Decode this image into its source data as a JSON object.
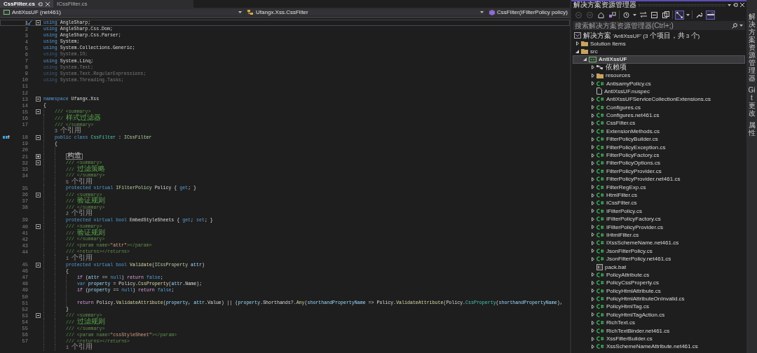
{
  "editor": {
    "tabs": [
      {
        "label": "CssFilter.cs",
        "selected": true
      },
      {
        "label": "ICssFilter.cs",
        "selected": false
      }
    ],
    "nav": {
      "project": "AntiXssUF (net461)",
      "type": "Ufangx.Xss.CssFilter",
      "member": "CssFilter(IFilterPolicy policy)"
    },
    "lines": [
      {
        "n": "1",
        "current": true,
        "expanded": true,
        "quick_action": true,
        "s": [
          {
            "kind": "kw",
            "text": "using"
          },
          {
            "kind": "plain",
            "text": " AngleSharp;"
          }
        ]
      },
      {
        "n": "2",
        "s": [
          {
            "kind": "kw",
            "text": "using"
          },
          {
            "kind": "plain",
            "text": " AngleSharp.Css.Dom;"
          }
        ]
      },
      {
        "n": "3",
        "s": [
          {
            "kind": "kw",
            "text": "using"
          },
          {
            "kind": "plain",
            "text": " AngleSharp.Css.Parser;"
          }
        ]
      },
      {
        "n": "4",
        "s": [
          {
            "kind": "kw",
            "text": "using"
          },
          {
            "kind": "plain",
            "text": " System;"
          }
        ]
      },
      {
        "n": "5",
        "s": [
          {
            "kind": "kw",
            "text": "using"
          },
          {
            "kind": "plain",
            "text": " System.Collections.Generic;"
          }
        ]
      },
      {
        "n": "6",
        "s": [
          {
            "kind": "dimkw",
            "text": "using"
          },
          {
            "kind": "dim",
            "text": " System.IO;"
          }
        ]
      },
      {
        "n": "7",
        "s": [
          {
            "kind": "kw",
            "text": "using"
          },
          {
            "kind": "plain",
            "text": " System.Linq;"
          }
        ]
      },
      {
        "n": "8",
        "s": [
          {
            "kind": "dimkw",
            "text": "using"
          },
          {
            "kind": "dim",
            "text": " System.Text;"
          }
        ]
      },
      {
        "n": "9",
        "s": [
          {
            "kind": "dimkw",
            "text": "using"
          },
          {
            "kind": "dim",
            "text": " System.Text.RegularExpressions;"
          }
        ]
      },
      {
        "n": "10",
        "s": [
          {
            "kind": "dimkw",
            "text": "using"
          },
          {
            "kind": "dim",
            "text": " System.Threading.Tasks;"
          }
        ]
      },
      {
        "n": "11"
      },
      {
        "n": "12"
      },
      {
        "n": "13",
        "expanded": true,
        "s": [
          {
            "kind": "kw",
            "text": "namespace"
          },
          {
            "kind": "plain",
            "text": " Ufangx.Xss"
          }
        ]
      },
      {
        "n": "14",
        "s": [
          {
            "kind": "plain",
            "text": "{"
          }
        ],
        "children": [
          {
            "n": "15",
            "expanded": true,
            "s": [
              {
                "kind": "cmt",
                "text": "/// "
              },
              {
                "kind": "xml",
                "text": "<summary>"
              }
            ]
          },
          {
            "n": "16",
            "s": [
              {
                "kind": "cmt",
                "text": "/// 样式过滤器"
              }
            ]
          },
          {
            "n": "17",
            "s": [
              {
                "kind": "cmt",
                "text": "/// "
              },
              {
                "kind": "xml",
                "text": "</summary>"
              }
            ]
          },
          {
            "kind": "lens",
            "text": "3 个引用"
          },
          {
            "n": "18",
            "expanded": true,
            "implements": true,
            "s": [
              {
                "kind": "kw",
                "text": "public class "
              },
              {
                "kind": "type",
                "text": "CssFilter"
              },
              {
                "kind": "plain",
                "text": " : "
              },
              {
                "kind": "iface",
                "text": "ICssFilter"
              }
            ]
          },
          {
            "n": "19",
            "s": [
              {
                "kind": "plain",
                "text": "{"
              }
            ],
            "children": [
              {
                "n": "20"
              },
              {
                "n": "21",
                "expanded": false,
                "s": [
                  {
                    "kind": "box",
                    "text": "构造"
                  }
                ]
              },
              {
                "n": "32",
                "expanded": true,
                "s": [
                  {
                    "kind": "cmt",
                    "text": "/// "
                  },
                  {
                    "kind": "xml",
                    "text": "<summary>"
                  }
                ]
              },
              {
                "n": "33",
                "s": [
                  {
                    "kind": "cmt",
                    "text": "/// 过滤策略"
                  }
                ]
              },
              {
                "n": "34",
                "s": [
                  {
                    "kind": "cmt",
                    "text": "/// "
                  },
                  {
                    "kind": "xml",
                    "text": "</summary>"
                  }
                ]
              },
              {
                "kind": "lens",
                "text": "5 个引用"
              },
              {
                "n": "35",
                "s": [
                  {
                    "kind": "kw",
                    "text": "protected virtual "
                  },
                  {
                    "kind": "iface",
                    "text": "IFilterPolicy"
                  },
                  {
                    "kind": "plain",
                    "text": " Policy { "
                  },
                  {
                    "kind": "kw",
                    "text": "get"
                  },
                  {
                    "kind": "plain",
                    "text": "; }"
                  }
                ]
              },
              {
                "n": "36",
                "expanded": true,
                "s": [
                  {
                    "kind": "cmt",
                    "text": "/// "
                  },
                  {
                    "kind": "xml",
                    "text": "<summary>"
                  }
                ]
              },
              {
                "n": "37",
                "s": [
                  {
                    "kind": "cmt",
                    "text": "/// 验证规则"
                  }
                ]
              },
              {
                "n": "38",
                "s": [
                  {
                    "kind": "cmt",
                    "text": "/// "
                  },
                  {
                    "kind": "xml",
                    "text": "</summary>"
                  }
                ]
              },
              {
                "kind": "lens",
                "text": "2 个引用"
              },
              {
                "n": "39",
                "s": [
                  {
                    "kind": "kw",
                    "text": "protected virtual bool"
                  },
                  {
                    "kind": "plain",
                    "text": " EmbedStyleSheets { "
                  },
                  {
                    "kind": "kw",
                    "text": "get"
                  },
                  {
                    "kind": "plain",
                    "text": "; "
                  },
                  {
                    "kind": "kw",
                    "text": "set"
                  },
                  {
                    "kind": "plain",
                    "text": "; }"
                  }
                ]
              },
              {
                "n": "40",
                "expanded": true,
                "s": [
                  {
                    "kind": "cmt",
                    "text": "/// "
                  },
                  {
                    "kind": "xml",
                    "text": "<summary>"
                  }
                ]
              },
              {
                "n": "41",
                "s": [
                  {
                    "kind": "cmt",
                    "text": "/// 验证规则"
                  }
                ]
              },
              {
                "n": "42",
                "s": [
                  {
                    "kind": "cmt",
                    "text": "/// "
                  },
                  {
                    "kind": "xml",
                    "text": "</summary>"
                  }
                ]
              },
              {
                "n": "43",
                "s": [
                  {
                    "kind": "cmt",
                    "text": "/// "
                  },
                  {
                    "kind": "xml",
                    "text": "<param name="
                  },
                  {
                    "kind": "str",
                    "text": "\"attr\""
                  },
                  {
                    "kind": "xml",
                    "text": "></param>"
                  }
                ]
              },
              {
                "n": "44",
                "s": [
                  {
                    "kind": "cmt",
                    "text": "/// "
                  },
                  {
                    "kind": "xml",
                    "text": "<returns></returns>"
                  }
                ]
              },
              {
                "kind": "lens",
                "text": "1 个引用"
              },
              {
                "n": "45",
                "expanded": true,
                "s": [
                  {
                    "kind": "kw",
                    "text": "protected virtual bool "
                  },
                  {
                    "kind": "method",
                    "text": "Validate"
                  },
                  {
                    "kind": "plain",
                    "text": "("
                  },
                  {
                    "kind": "iface",
                    "text": "ICssProperty"
                  },
                  {
                    "kind": "var",
                    "text": " attr"
                  },
                  {
                    "kind": "plain",
                    "text": ")"
                  }
                ]
              },
              {
                "n": "46",
                "s": [
                  {
                    "kind": "plain",
                    "text": "{"
                  }
                ],
                "children": [
                  {
                    "n": "47",
                    "s": [
                      {
                        "kind": "ctl",
                        "text": "if"
                      },
                      {
                        "kind": "plain",
                        "text": " ("
                      },
                      {
                        "kind": "var",
                        "text": "attr"
                      },
                      {
                        "kind": "plain",
                        "text": " == "
                      },
                      {
                        "kind": "kw",
                        "text": "null"
                      },
                      {
                        "kind": "plain",
                        "text": ") "
                      },
                      {
                        "kind": "ctl",
                        "text": "return"
                      },
                      {
                        "kind": "kw",
                        "text": " false"
                      },
                      {
                        "kind": "plain",
                        "text": ";"
                      }
                    ]
                  },
                  {
                    "n": "48",
                    "s": [
                      {
                        "kind": "kw",
                        "text": "var"
                      },
                      {
                        "kind": "var",
                        "text": " property"
                      },
                      {
                        "kind": "plain",
                        "text": " = Policy."
                      },
                      {
                        "kind": "method",
                        "text": "CssProperty"
                      },
                      {
                        "kind": "plain",
                        "text": "("
                      },
                      {
                        "kind": "var",
                        "text": "attr"
                      },
                      {
                        "kind": "plain",
                        "text": ".Name);"
                      }
                    ]
                  },
                  {
                    "n": "49",
                    "s": [
                      {
                        "kind": "ctl",
                        "text": "if"
                      },
                      {
                        "kind": "plain",
                        "text": " ("
                      },
                      {
                        "kind": "var",
                        "text": "property"
                      },
                      {
                        "kind": "plain",
                        "text": " == "
                      },
                      {
                        "kind": "kw",
                        "text": "null"
                      },
                      {
                        "kind": "plain",
                        "text": ") "
                      },
                      {
                        "kind": "ctl",
                        "text": "return"
                      },
                      {
                        "kind": "kw",
                        "text": " false"
                      },
                      {
                        "kind": "plain",
                        "text": ";"
                      }
                    ]
                  },
                  {
                    "n": "50"
                  },
                  {
                    "n": "51",
                    "s": [
                      {
                        "kind": "ctl",
                        "text": "return"
                      },
                      {
                        "kind": "plain",
                        "text": " Policy."
                      },
                      {
                        "kind": "method",
                        "text": "ValidateAttribute"
                      },
                      {
                        "kind": "plain",
                        "text": "("
                      },
                      {
                        "kind": "var",
                        "text": "property"
                      },
                      {
                        "kind": "plain",
                        "text": ", "
                      },
                      {
                        "kind": "var",
                        "text": "attr"
                      },
                      {
                        "kind": "plain",
                        "text": ".Value) || ("
                      },
                      {
                        "kind": "var",
                        "text": "property"
                      },
                      {
                        "kind": "plain",
                        "text": ".Shorthands?."
                      },
                      {
                        "kind": "method",
                        "text": "Any"
                      },
                      {
                        "kind": "plain",
                        "text": "("
                      },
                      {
                        "kind": "var",
                        "text": "shorthandPropertyName"
                      },
                      {
                        "kind": "plain",
                        "text": " => Policy."
                      },
                      {
                        "kind": "method",
                        "text": "ValidateAttribute"
                      },
                      {
                        "kind": "plain",
                        "text": "(Policy."
                      },
                      {
                        "kind": "type",
                        "text": "CssProperty"
                      },
                      {
                        "kind": "plain",
                        "text": "("
                      },
                      {
                        "kind": "var",
                        "text": "shorthandPropertyName"
                      },
                      {
                        "kind": "plain",
                        "text": "),"
                      }
                    ]
                  }
                ]
              },
              {
                "n": "52",
                "s": [
                  {
                    "kind": "plain",
                    "text": "}"
                  }
                ]
              },
              {
                "n": "53",
                "expanded": true,
                "s": [
                  {
                    "kind": "cmt",
                    "text": "/// "
                  },
                  {
                    "kind": "xml",
                    "text": "<summary>"
                  }
                ]
              },
              {
                "n": "54",
                "s": [
                  {
                    "kind": "cmt",
                    "text": "/// 过滤规则"
                  }
                ]
              },
              {
                "n": "55",
                "s": [
                  {
                    "kind": "cmt",
                    "text": "/// "
                  },
                  {
                    "kind": "xml",
                    "text": "</summary>"
                  }
                ]
              },
              {
                "n": "56",
                "s": [
                  {
                    "kind": "cmt",
                    "text": "/// "
                  },
                  {
                    "kind": "xml",
                    "text": "<param name="
                  },
                  {
                    "kind": "str",
                    "text": "\"cssStyleSheet\""
                  },
                  {
                    "kind": "xml",
                    "text": "></param>"
                  }
                ]
              },
              {
                "n": "57",
                "s": [
                  {
                    "kind": "cmt",
                    "text": "/// "
                  },
                  {
                    "kind": "xml",
                    "text": "<returns></returns>"
                  }
                ]
              },
              {
                "kind": "lens",
                "text": "1 个引用"
              }
            ]
          }
        ]
      }
    ]
  },
  "solution_explorer": {
    "title": "解决方案资源管理器",
    "search": {
      "placeholder": "搜索解决方案资源管理器(Ctrl+;)"
    },
    "tree": {
      "label": "解决方案 'AntiXssUF' (3 个项目，共 3 个)",
      "kind": "solution",
      "selected": false,
      "children": [
        {
          "label": "Solution Items",
          "kind": "folder",
          "expanded": false,
          "selected": false
        },
        {
          "label": "src",
          "kind": "folder",
          "expanded": true,
          "selected": false,
          "children": [
            {
              "label": "AntiXssUF",
              "kind": "project",
              "expanded": true,
              "selected": true,
              "children": [
                {
                  "label": "依赖项",
                  "kind": "deps",
                  "expanded": false,
                  "selected": false
                },
                {
                  "label": "resources",
                  "kind": "folder",
                  "expanded": false,
                  "selected": false
                },
                {
                  "label": "AntisamyPolicy.cs",
                  "kind": "csharp",
                  "expanded": false,
                  "selected": false
                },
                {
                  "label": "AntiXssUF.nuspec",
                  "kind": "file",
                  "selected": false
                },
                {
                  "label": "AntiXssUFServiceCollectionExtensions.cs",
                  "kind": "csharp",
                  "expanded": false,
                  "selected": false
                },
                {
                  "label": "Configures.cs",
                  "kind": "csharp",
                  "expanded": false,
                  "selected": false
                },
                {
                  "label": "Configures.net461.cs",
                  "kind": "csharp",
                  "expanded": false,
                  "selected": false
                },
                {
                  "label": "CssFilter.cs",
                  "kind": "csharp",
                  "expanded": false,
                  "selected": false
                },
                {
                  "label": "ExtensionMethods.cs",
                  "kind": "csharp",
                  "expanded": false,
                  "selected": false
                },
                {
                  "label": "FilterPolicyBuilder.cs",
                  "kind": "csharp",
                  "expanded": false,
                  "selected": false
                },
                {
                  "label": "FilterPolicyException.cs",
                  "kind": "csharp",
                  "expanded": false,
                  "selected": false
                },
                {
                  "label": "FilterPolicyFactory.cs",
                  "kind": "csharp",
                  "expanded": false,
                  "selected": false
                },
                {
                  "label": "FilterPolicyOptions.cs",
                  "kind": "csharp",
                  "expanded": false,
                  "selected": false
                },
                {
                  "label": "FilterPolicyProvider.cs",
                  "kind": "csharp",
                  "expanded": false,
                  "selected": false
                },
                {
                  "label": "FilterPolicyProvider.net461.cs",
                  "kind": "csharp",
                  "expanded": false,
                  "selected": false
                },
                {
                  "label": "FilterRegExp.cs",
                  "kind": "csharp",
                  "expanded": false,
                  "selected": false
                },
                {
                  "label": "HtmlFilter.cs",
                  "kind": "csharp",
                  "expanded": false,
                  "selected": false
                },
                {
                  "label": "ICssFilter.cs",
                  "kind": "csharp",
                  "expanded": false,
                  "selected": false
                },
                {
                  "label": "IFilterPolicy.cs",
                  "kind": "csharp",
                  "expanded": false,
                  "selected": false
                },
                {
                  "label": "IFilterPolicyFactory.cs",
                  "kind": "csharp",
                  "expanded": false,
                  "selected": false
                },
                {
                  "label": "IFilterPolicyProvider.cs",
                  "kind": "csharp",
                  "expanded": false,
                  "selected": false
                },
                {
                  "label": "IHtmlFilter.cs",
                  "kind": "csharp",
                  "expanded": false,
                  "selected": false
                },
                {
                  "label": "IXssSchemeName.net461.cs",
                  "kind": "csharp",
                  "expanded": false,
                  "selected": false
                },
                {
                  "label": "JsonFilterPolicy.cs",
                  "kind": "csharp",
                  "expanded": false,
                  "selected": false
                },
                {
                  "label": "JsonFilterPolicy.net461.cs",
                  "kind": "csharp",
                  "expanded": false,
                  "selected": false
                },
                {
                  "label": "pack.bat",
                  "kind": "bat",
                  "selected": false
                },
                {
                  "label": "PolicyAttribute.cs",
                  "kind": "csharp",
                  "expanded": false,
                  "selected": false
                },
                {
                  "label": "PolicyCssProperty.cs",
                  "kind": "csharp",
                  "expanded": false,
                  "selected": false
                },
                {
                  "label": "PolicyHtmlAttribute.cs",
                  "kind": "csharp",
                  "expanded": false,
                  "selected": false
                },
                {
                  "label": "PolicyHtmlAttributeOnInvalid.cs",
                  "kind": "csharp",
                  "expanded": false,
                  "selected": false
                },
                {
                  "label": "PolicyHtmlTag.cs",
                  "kind": "csharp",
                  "expanded": false,
                  "selected": false
                },
                {
                  "label": "PolicyHtmlTagAction.cs",
                  "kind": "csharp",
                  "expanded": false,
                  "selected": false
                },
                {
                  "label": "RichText.cs",
                  "kind": "csharp",
                  "expanded": false,
                  "selected": false
                },
                {
                  "label": "RichTextBinder.net461.cs",
                  "kind": "csharp",
                  "expanded": false,
                  "selected": false
                },
                {
                  "label": "XssFilterBuilder.cs",
                  "kind": "csharp",
                  "expanded": false,
                  "selected": false
                },
                {
                  "label": "XssSchemeNameAttribute.net461.cs",
                  "kind": "csharp",
                  "expanded": false,
                  "selected": false
                }
              ]
            }
          ]
        }
      ]
    }
  },
  "side_tabs": [
    "解决方案资源管理器",
    "Git 更改",
    "属性"
  ]
}
